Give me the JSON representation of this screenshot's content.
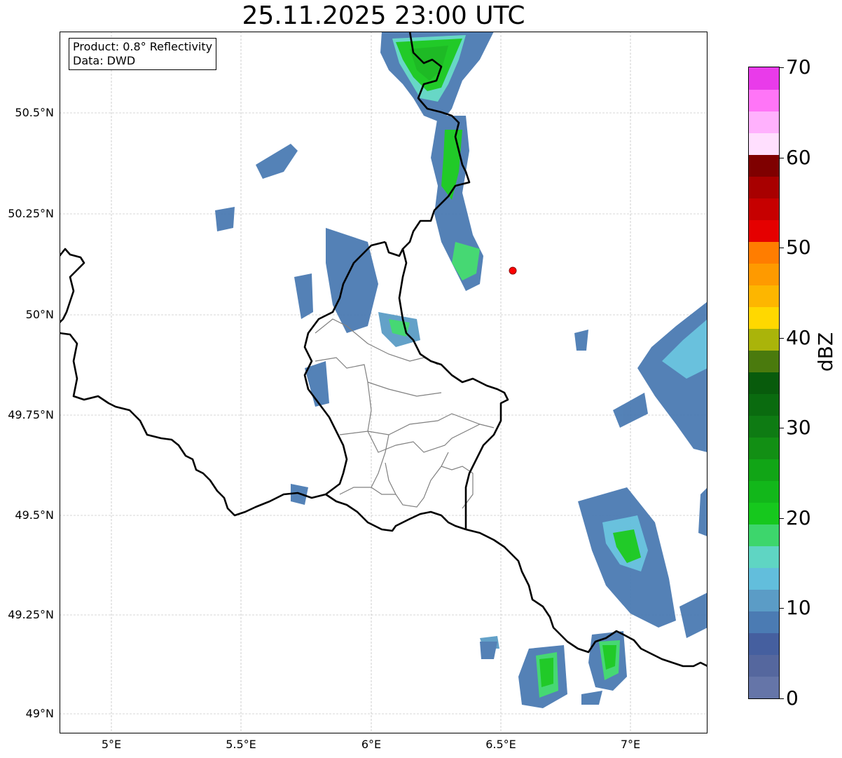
{
  "title": "25.11.2025 23:00 UTC",
  "info": {
    "product": "Product: 0.8° Reflectivity",
    "data": "Data: DWD"
  },
  "axes": {
    "lat_ticks": [
      "50.5°N",
      "50.25°N",
      "50°N",
      "49.75°N",
      "49.5°N",
      "49.25°N",
      "49°N"
    ],
    "lon_ticks": [
      "5°E",
      "5.5°E",
      "6°E",
      "6.5°E",
      "7°E"
    ]
  },
  "colorbar": {
    "label": "dBZ",
    "ticks": [
      "0",
      "10",
      "20",
      "30",
      "40",
      "50",
      "60",
      "70"
    ],
    "colors": [
      "#6575a8",
      "#55679e",
      "#455f9f",
      "#4b7bb3",
      "#5b9cc6",
      "#62bedc",
      "#5fd5c3",
      "#3dd66c",
      "#16c81d",
      "#12b71a",
      "#11a516",
      "#128f14",
      "#0e7b13",
      "#0a6b0f",
      "#085b0c",
      "#4a7a0d",
      "#aab40a",
      "#ffd800",
      "#fdb600",
      "#fe9a00",
      "#ff7d00",
      "#e50000",
      "#c60000",
      "#a80000",
      "#7f0000",
      "#ffdffe",
      "#ffb1fd",
      "#ff75f7",
      "#e93bea"
    ]
  },
  "marker": {
    "label": "radar-site",
    "color": "#ff0000"
  },
  "map_colors": {
    "border": "#000000",
    "district": "#808080",
    "grid": "#b0b0b0"
  }
}
